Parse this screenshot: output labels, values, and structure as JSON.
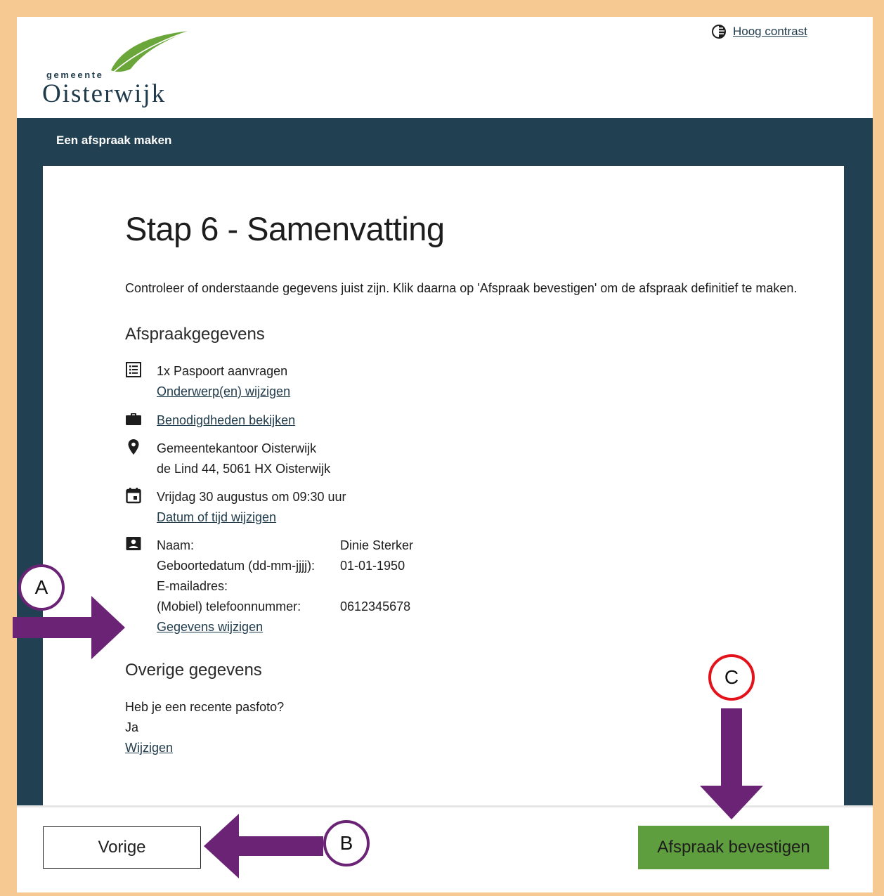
{
  "header": {
    "logo_small": "gemeente",
    "logo_big": "Oisterwijk",
    "contrast_label": "Hoog contrast"
  },
  "band": {
    "title": "Een afspraak maken"
  },
  "page": {
    "title": "Stap 6 - Samenvatting",
    "intro": "Controleer of onderstaande gegevens juist zijn. Klik daarna op 'Afspraak bevestigen' om de afspraak definitief te maken."
  },
  "appointment": {
    "heading": "Afspraakgegevens",
    "subject": "1x Paspoort aanvragen",
    "subject_link": "Onderwerp(en) wijzigen",
    "needs_link": "Benodigdheden bekijken",
    "location_line1": "Gemeentekantoor Oisterwijk",
    "location_line2": "de Lind 44, 5061 HX Oisterwijk",
    "datetime": "Vrijdag 30 augustus om 09:30 uur",
    "datetime_link": "Datum of tijd wijzigen",
    "person": {
      "name_label": "Naam:",
      "name_value": "Dinie Sterker",
      "birth_label": "Geboortedatum (dd-mm-jjjj):",
      "birth_value": "01-01-1950",
      "email_label": "E-mailadres:",
      "email_value": "",
      "phone_label": "(Mobiel) telefoonnummer:",
      "phone_value": "0612345678"
    },
    "person_link": "Gegevens wijzigen"
  },
  "other": {
    "heading": "Overige gegevens",
    "question": "Heb je een recente pasfoto?",
    "answer": "Ja",
    "change_link": "Wijzigen"
  },
  "footer": {
    "prev_label": "Vorige",
    "confirm_label": "Afspraak bevestigen"
  },
  "annotations": {
    "a_label": "A",
    "b_label": "B",
    "c_label": "C",
    "arrow_color": "#6a2375",
    "circle_ab_color": "#6a2375",
    "circle_c_color": "#e4121a"
  },
  "colors": {
    "frame": "#f6c993",
    "band": "#214052",
    "confirm_button": "#5f9e3e",
    "link": "#1f3a4a"
  }
}
